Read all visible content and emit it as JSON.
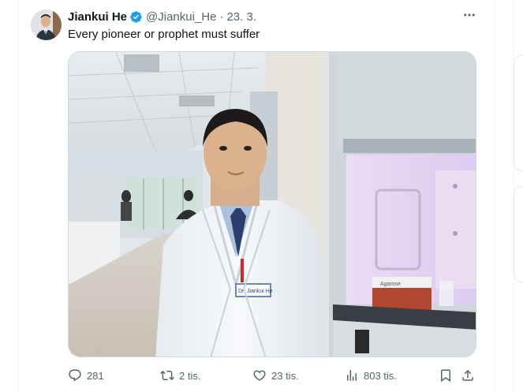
{
  "tweet": {
    "author_name": "Jiankui He",
    "handle": "@Jiankui_He",
    "separator": "·",
    "date": "23. 3.",
    "text": "Every pioneer or prophet must suffer",
    "verified": true,
    "badge_color": "#1d9bf0"
  },
  "media": {
    "name_tag": "Dr. Jiankui He",
    "packaging_label": "Agarose"
  },
  "actions": {
    "replies": "281",
    "reposts": "2 tis.",
    "likes": "23 tis.",
    "views": "803 tis."
  },
  "icons": [
    "more-icon",
    "reply-icon",
    "repost-icon",
    "like-icon",
    "views-icon",
    "bookmark-icon",
    "share-icon"
  ],
  "colors": {
    "text_primary": "#0f1419",
    "text_secondary": "#536471",
    "accent": "#1d9bf0"
  }
}
